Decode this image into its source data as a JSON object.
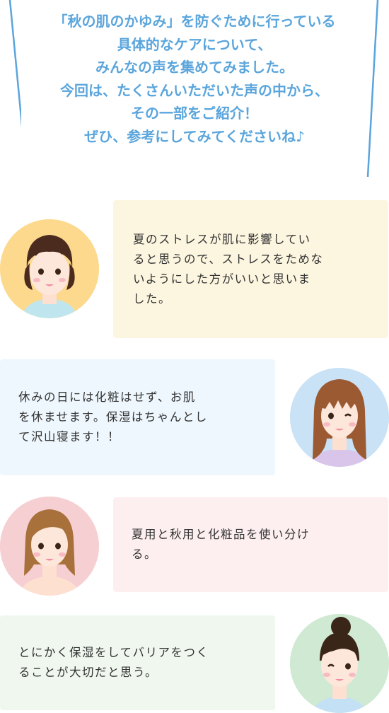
{
  "intro": {
    "lines": [
      "「秋の肌のかゆみ」を防ぐために行っている",
      "具体的なケアについて、",
      "みんなの声を集めてみました。",
      "今回は、たくさんいただいた声の中から、",
      "その一部をご紹介！",
      "ぜひ、参考にしてみてくださいね♪"
    ]
  },
  "comments": [
    {
      "text": "夏のストレスが肌に影響しているると思うので、ストレスをためないようにした方がいいと思いました。",
      "display": "夏のストレスが肌に影響してい\nると思うので、ストレスをためな\nいようにした方がいいと思いま\nした。",
      "bubble_color": "#fcf6e0",
      "avatar_bg": "#fdd98e"
    },
    {
      "display": "休みの日には化粧はせず、お肌\nを休ませます。保湿はちゃんとし\nて沢山寝ます！！",
      "bubble_color": "#eef7fd",
      "avatar_bg": "#c9e2f6"
    },
    {
      "display": "夏用と秋用と化粧品を使い分け\nる。",
      "bubble_color": "#fdeff0",
      "avatar_bg": "#f6cfd2"
    },
    {
      "display": "とにかく保湿をしてバリアをつく\nることが大切だと思う。",
      "bubble_color": "#eff7ef",
      "avatar_bg": "#cfe9d3"
    }
  ],
  "colors": {
    "accent_text": "#5aa5dc",
    "body_text": "#333333"
  }
}
